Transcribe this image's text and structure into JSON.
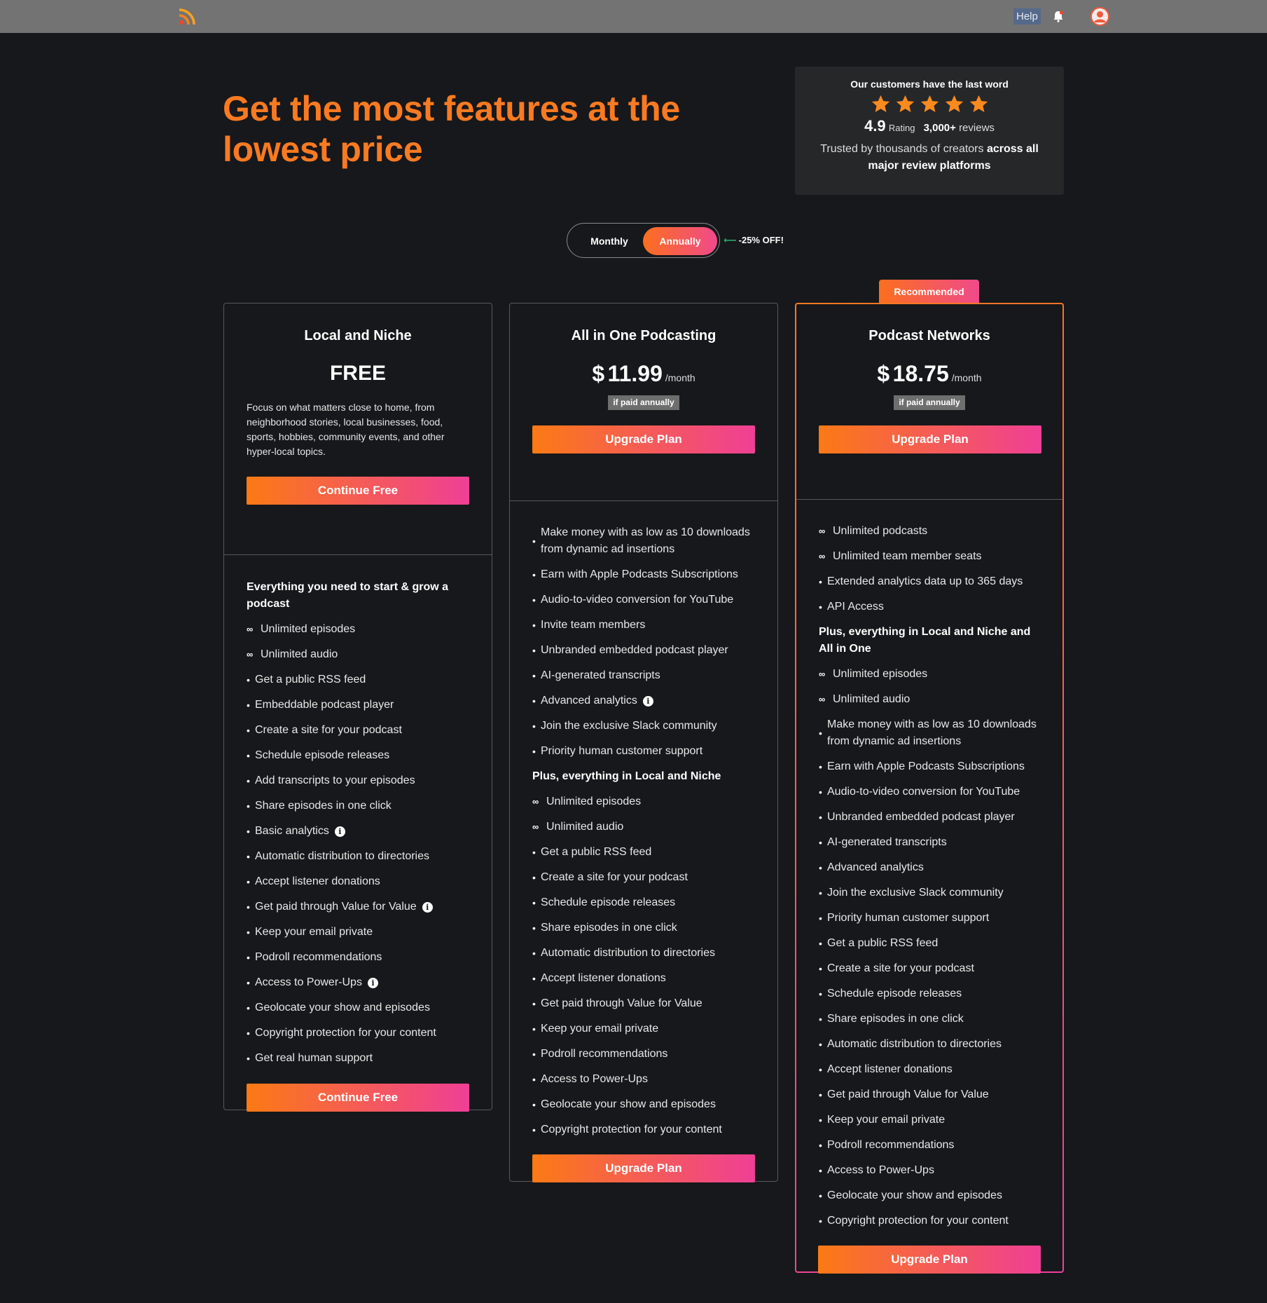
{
  "nav": {
    "help_label": "Help"
  },
  "hero": {
    "title": "Get the most features at the lowest price"
  },
  "ratings": {
    "title": "Our customers have the last word",
    "stars": 5,
    "score": "4.9",
    "score_label": "Rating",
    "count": "3,000+",
    "count_label": "reviews",
    "trust_prefix": "Trusted by thousands of creators",
    "trust_bold": "across all major review platforms"
  },
  "billing": {
    "monthly_label": "Monthly",
    "annually_label": "Annually",
    "selected": "Annually",
    "discount": "-25% OFF!"
  },
  "colors": {
    "accent_orange": "#fb7a14",
    "accent_pink": "#ef3f96",
    "background": "#16181b",
    "topbar": "#737373"
  },
  "plans": [
    {
      "name": "Local and Niche",
      "price": "FREE",
      "description": "Focus on what matters close to home, from neighborhood stories, local businesses, food, sports, hobbies, community events, and other hyper-local topics.",
      "cta": "Continue Free",
      "features": [
        {
          "type": "head",
          "text": "Everything you need to start & grow a podcast"
        },
        {
          "type": "infinity",
          "text": "Unlimited episodes"
        },
        {
          "type": "infinity",
          "text": "Unlimited audio"
        },
        {
          "type": "bullet",
          "text": "Get a public RSS feed"
        },
        {
          "type": "bullet",
          "text": "Embeddable podcast player"
        },
        {
          "type": "bullet",
          "text": "Create a site for your podcast"
        },
        {
          "type": "bullet",
          "text": "Schedule episode releases"
        },
        {
          "type": "bullet",
          "text": "Add transcripts to your episodes"
        },
        {
          "type": "bullet",
          "text": "Share episodes in one click"
        },
        {
          "type": "bullet",
          "text": "Basic analytics",
          "info": true
        },
        {
          "type": "bullet",
          "text": "Automatic distribution to directories"
        },
        {
          "type": "bullet",
          "text": "Accept listener donations"
        },
        {
          "type": "bullet",
          "text": "Get paid through Value for Value",
          "info": true
        },
        {
          "type": "bullet",
          "text": "Keep your email private"
        },
        {
          "type": "bullet",
          "text": "Podroll recommendations"
        },
        {
          "type": "bullet",
          "text": "Access to Power-Ups",
          "info": true
        },
        {
          "type": "bullet",
          "text": "Geolocate your show and episodes"
        },
        {
          "type": "bullet",
          "text": "Copyright protection for your content"
        },
        {
          "type": "bullet",
          "text": "Get real human support"
        }
      ]
    },
    {
      "name": "All in One Podcasting",
      "currency": "$",
      "price": "11.99",
      "period": "/month",
      "billing_note": "if paid annually",
      "cta": "Upgrade Plan",
      "features": [
        {
          "type": "bullet",
          "text": "Make money with as low as 10 downloads from dynamic ad insertions"
        },
        {
          "type": "bullet",
          "text": "Earn with Apple Podcasts Subscriptions"
        },
        {
          "type": "bullet",
          "text": "Audio-to-video conversion for YouTube"
        },
        {
          "type": "bullet",
          "text": "Invite team members"
        },
        {
          "type": "bullet",
          "text": "Unbranded embedded podcast player"
        },
        {
          "type": "bullet",
          "text": "AI-generated transcripts"
        },
        {
          "type": "bullet",
          "text": "Advanced analytics",
          "info": true
        },
        {
          "type": "bullet",
          "text": "Join the exclusive Slack community"
        },
        {
          "type": "bullet",
          "text": "Priority human customer support"
        },
        {
          "type": "head",
          "text": "Plus, everything in Local and Niche"
        },
        {
          "type": "infinity",
          "text": "Unlimited episodes"
        },
        {
          "type": "infinity",
          "text": "Unlimited audio"
        },
        {
          "type": "bullet",
          "text": "Get a public RSS feed"
        },
        {
          "type": "bullet",
          "text": "Create a site for your podcast"
        },
        {
          "type": "bullet",
          "text": "Schedule episode releases"
        },
        {
          "type": "bullet",
          "text": "Share episodes in one click"
        },
        {
          "type": "bullet",
          "text": "Automatic distribution to directories"
        },
        {
          "type": "bullet",
          "text": "Accept listener donations"
        },
        {
          "type": "bullet",
          "text": "Get paid through Value for Value"
        },
        {
          "type": "bullet",
          "text": "Keep your email private"
        },
        {
          "type": "bullet",
          "text": "Podroll recommendations"
        },
        {
          "type": "bullet",
          "text": "Access to Power-Ups"
        },
        {
          "type": "bullet",
          "text": "Geolocate your show and episodes"
        },
        {
          "type": "bullet",
          "text": "Copyright protection for your content"
        }
      ]
    },
    {
      "name": "Podcast Networks",
      "badge": "Recommended",
      "currency": "$",
      "price": "18.75",
      "period": "/month",
      "billing_note": "if paid annually",
      "cta": "Upgrade Plan",
      "features": [
        {
          "type": "infinity",
          "text": "Unlimited podcasts"
        },
        {
          "type": "infinity",
          "text": "Unlimited team member seats"
        },
        {
          "type": "bullet",
          "text": "Extended analytics data up to 365 days"
        },
        {
          "type": "bullet",
          "text": "API Access"
        },
        {
          "type": "head",
          "text": "Plus, everything in Local and Niche and All in One"
        },
        {
          "type": "infinity",
          "text": "Unlimited episodes"
        },
        {
          "type": "infinity",
          "text": "Unlimited audio"
        },
        {
          "type": "bullet",
          "text": "Make money with as low as 10 downloads from dynamic ad insertions"
        },
        {
          "type": "bullet",
          "text": "Earn with Apple Podcasts Subscriptions"
        },
        {
          "type": "bullet",
          "text": "Audio-to-video conversion for YouTube"
        },
        {
          "type": "bullet",
          "text": "Unbranded embedded podcast player"
        },
        {
          "type": "bullet",
          "text": "AI-generated transcripts"
        },
        {
          "type": "bullet",
          "text": "Advanced analytics"
        },
        {
          "type": "bullet",
          "text": "Join the exclusive Slack community"
        },
        {
          "type": "bullet",
          "text": "Priority human customer support"
        },
        {
          "type": "bullet",
          "text": "Get a public RSS feed"
        },
        {
          "type": "bullet",
          "text": "Create a site for your podcast"
        },
        {
          "type": "bullet",
          "text": "Schedule episode releases"
        },
        {
          "type": "bullet",
          "text": "Share episodes in one click"
        },
        {
          "type": "bullet",
          "text": "Automatic distribution to directories"
        },
        {
          "type": "bullet",
          "text": "Accept listener donations"
        },
        {
          "type": "bullet",
          "text": "Get paid through Value for Value"
        },
        {
          "type": "bullet",
          "text": "Keep your email private"
        },
        {
          "type": "bullet",
          "text": "Podroll recommendations"
        },
        {
          "type": "bullet",
          "text": "Access to Power-Ups"
        },
        {
          "type": "bullet",
          "text": "Geolocate your show and episodes"
        },
        {
          "type": "bullet",
          "text": "Copyright protection for your content"
        }
      ]
    }
  ]
}
